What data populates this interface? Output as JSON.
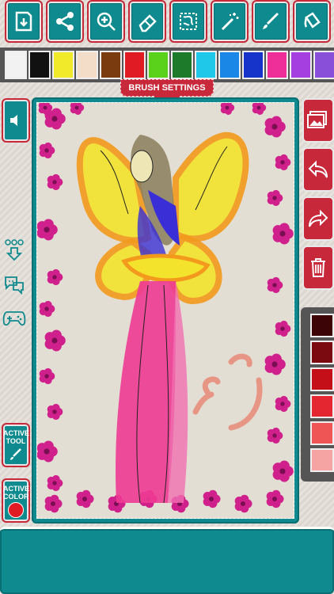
{
  "toolbar": {
    "tools": [
      {
        "name": "save-icon"
      },
      {
        "name": "share-icon"
      },
      {
        "name": "zoom-icon"
      },
      {
        "name": "eraser-icon"
      },
      {
        "name": "pattern-icon"
      },
      {
        "name": "magic-wand-icon"
      },
      {
        "name": "brush-icon"
      },
      {
        "name": "bucket-icon"
      }
    ]
  },
  "palette": {
    "colors": [
      "#f2f2f2",
      "#111111",
      "#f0ea2a",
      "#f3dcc8",
      "#7a3b0e",
      "#e01b24",
      "#5ad21c",
      "#1d7a2a",
      "#1fc7e8",
      "#1a86e6",
      "#1634c9",
      "#ee2f9a",
      "#a53fe0",
      "#8a4fd8"
    ]
  },
  "brush_settings": {
    "label": "BRUSH SETTINGS"
  },
  "left_panel": {
    "active_tool_label_1": "ACTIVE",
    "active_tool_label_2": "TOOL",
    "active_color_label_1": "ACTIVE",
    "active_color_label_2": "COLOR",
    "active_color": "#e01b24"
  },
  "shades": [
    "#3d0408",
    "#7a0a10",
    "#c40f18",
    "#e32630",
    "#ef5555",
    "#f6a3a3"
  ],
  "drawing": {
    "wing_color": "#f3e32c",
    "wing_outline": "#f39a1c",
    "dress_color": "#ee3a93",
    "hair_color": "#3a2fd6",
    "flower_color": "#d0208c"
  }
}
